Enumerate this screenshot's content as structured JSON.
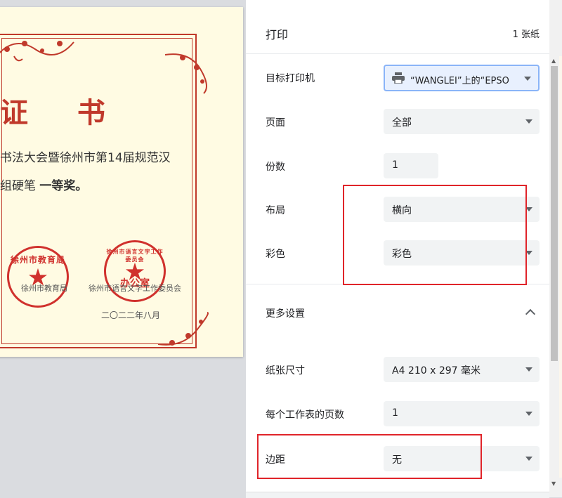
{
  "preview": {
    "certificate": {
      "title": "证 书",
      "line1": "书法大会暨徐州市第14届规范汉",
      "line2_prefix": "组硬笔",
      "line2_award": "一等奖。",
      "issuer1": "徐州市教育局",
      "issuer2": "徐州市语言文字工作委员会",
      "date": "二〇二二年八月",
      "seal1_top": "徐州市教育局",
      "seal2_top": "徐州市语言文字工作委员会",
      "seal2_bottom": "办公室"
    }
  },
  "panel": {
    "title": "打印",
    "sheet_count": "1 张纸",
    "rows": {
      "destination": {
        "label": "目标打印机",
        "value": "“WANGLEI”上的“EPSO"
      },
      "pages": {
        "label": "页面",
        "value": "全部"
      },
      "copies": {
        "label": "份数",
        "value": "1"
      },
      "layout": {
        "label": "布局",
        "value": "横向"
      },
      "color": {
        "label": "彩色",
        "value": "彩色"
      }
    },
    "more_settings": "更多设置",
    "more": {
      "paper_size": {
        "label": "纸张尺寸",
        "value": "A4 210 x 297 毫米"
      },
      "pages_per_sheet": {
        "label": "每个工作表的页数",
        "value": "1"
      },
      "margins": {
        "label": "边距",
        "value": "无"
      }
    }
  },
  "colors": {
    "accent": "#1a73e8",
    "highlight_red": "#e0242a",
    "certificate_red": "#c0392b",
    "certificate_bg": "#fffbe3"
  },
  "icons": {
    "printer": "printer-icon",
    "dropdown": "chevron-down-icon",
    "collapse": "chevron-up-icon",
    "seal_star": "star-icon"
  }
}
